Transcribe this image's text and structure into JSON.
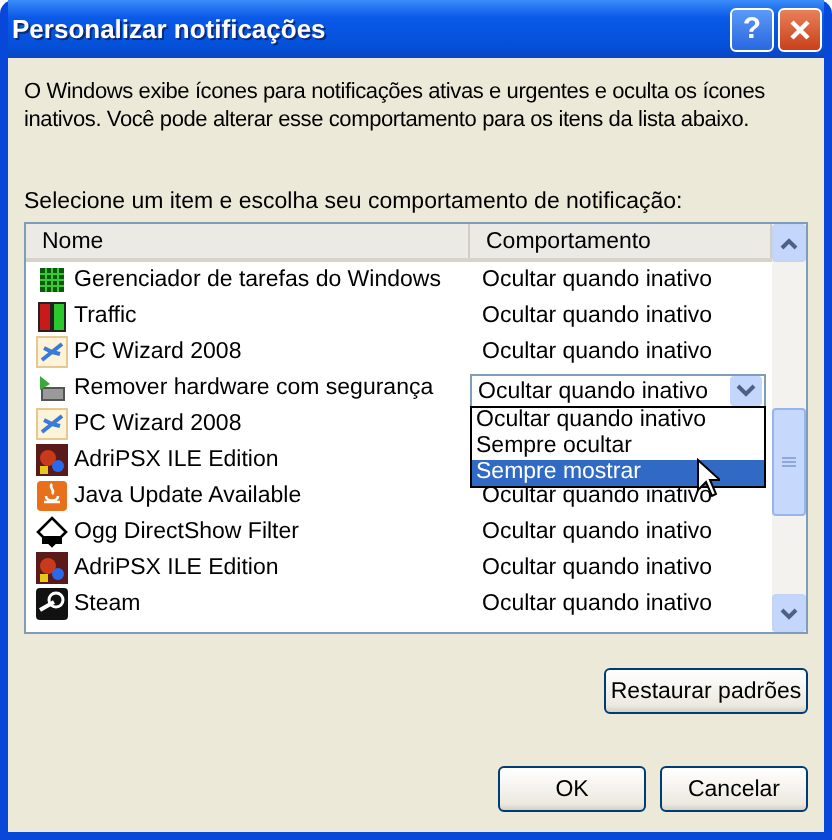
{
  "window": {
    "title": "Personalizar notificações",
    "help_button": "?"
  },
  "description": "O Windows exibe ícones para notificações ativas e urgentes e oculta os ícones inativos. Você pode alterar esse comportamento para os itens da lista abaixo.",
  "list_label": "Selecione um item e escolha seu comportamento de notificação:",
  "columns": [
    "Nome",
    "Comportamento"
  ],
  "rows": [
    {
      "name": "Gerenciador de tarefas do Windows",
      "behavior": "Ocultar quando inativo",
      "selected": false
    },
    {
      "name": "Traffic",
      "behavior": "Ocultar quando inativo",
      "selected": false
    },
    {
      "name": "PC Wizard 2008",
      "behavior": "Ocultar quando inativo",
      "selected": false
    },
    {
      "name": "Remover hardware com segurança",
      "behavior": "Ocultar quando inativo",
      "selected": true
    },
    {
      "name": "PC Wizard 2008",
      "selected": false
    },
    {
      "name": "AdriPSX ILE Edition",
      "selected": false
    },
    {
      "name": "Java Update Available",
      "behavior": "Ocultar quando inativo",
      "selected": false
    },
    {
      "name": "Ogg DirectShow Filter",
      "behavior": "Ocultar quando inativo",
      "selected": false
    },
    {
      "name": "AdriPSX ILE Edition",
      "behavior": "Ocultar quando inativo",
      "selected": false
    },
    {
      "name": "Steam",
      "behavior": "Ocultar quando inativo",
      "selected": false
    }
  ],
  "dropdown": {
    "options": [
      {
        "label": "Ocultar quando inativo",
        "selected": false
      },
      {
        "label": "Sempre ocultar",
        "selected": false
      },
      {
        "label": "Sempre mostrar",
        "selected": true
      }
    ]
  },
  "restore_button": "Restaurar padrões",
  "buttons": [
    "OK",
    "Cancelar"
  ]
}
